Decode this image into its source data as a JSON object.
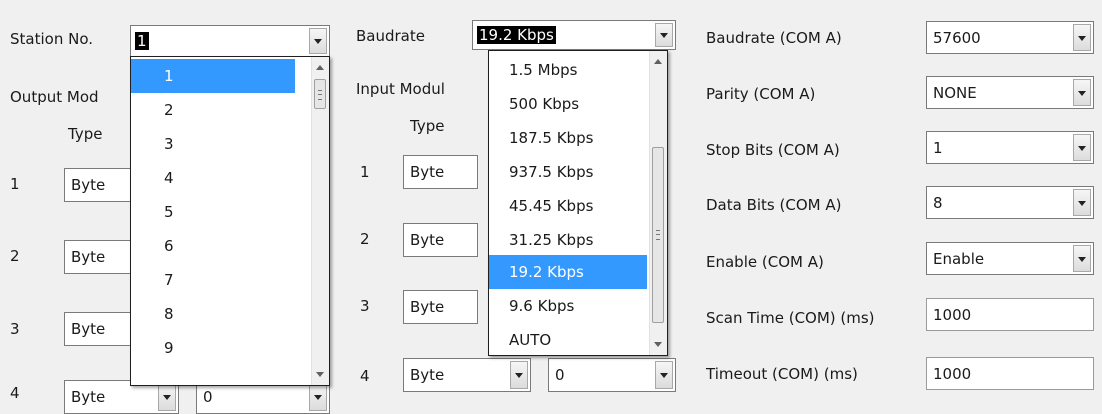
{
  "left": {
    "station_label": "Station No.",
    "station_value": "1",
    "output_label": "Output Mod",
    "type_label": "Type",
    "rows": [
      {
        "num": "1",
        "type": "Byte"
      },
      {
        "num": "2",
        "type": "Byte"
      },
      {
        "num": "3",
        "type": "Byte"
      },
      {
        "num": "4",
        "type": "Byte",
        "value": "0"
      }
    ],
    "dropdown_items": [
      "1",
      "2",
      "3",
      "4",
      "5",
      "6",
      "7",
      "8",
      "9"
    ],
    "dropdown_selected": "1"
  },
  "middle": {
    "baudrate_label": "Baudrate",
    "baudrate_value": "19.2 Kbps",
    "input_label": "Input Modul",
    "type_label": "Type",
    "rows": [
      {
        "num": "1",
        "type": "Byte"
      },
      {
        "num": "2",
        "type": "Byte"
      },
      {
        "num": "3",
        "type": "Byte"
      },
      {
        "num": "4",
        "type": "Byte",
        "value": "0"
      }
    ],
    "dropdown_items": [
      "1.5 Mbps",
      "500 Kbps",
      "187.5 Kbps",
      "937.5 Kbps",
      "45.45 Kbps",
      "31.25 Kbps",
      "19.2 Kbps",
      "9.6 Kbps",
      "AUTO"
    ],
    "dropdown_selected": "19.2 Kbps"
  },
  "right": {
    "fields": [
      {
        "label": "Baudrate (COM A)",
        "value": "57600",
        "kind": "combo"
      },
      {
        "label": "Parity (COM A)",
        "value": "NONE",
        "kind": "combo"
      },
      {
        "label": "Stop Bits (COM A)",
        "value": "1",
        "kind": "combo"
      },
      {
        "label": "Data Bits (COM A)",
        "value": "8",
        "kind": "combo"
      },
      {
        "label": "Enable (COM A)",
        "value": "Enable",
        "kind": "combo"
      },
      {
        "label": "Scan Time (COM) (ms)",
        "value": "1000",
        "kind": "text"
      },
      {
        "label": "Timeout (COM) (ms)",
        "value": "1000",
        "kind": "text"
      }
    ]
  },
  "icons": {
    "dropdown_arrow": "chevron-down-icon",
    "scroll_up": "scroll-up-icon",
    "scroll_down": "scroll-down-icon",
    "scroll_grip": "scroll-grip-icon"
  },
  "colors": {
    "background": "#f0f0f0",
    "selection": "#3399ff",
    "selected_text_bg": "#000000"
  }
}
